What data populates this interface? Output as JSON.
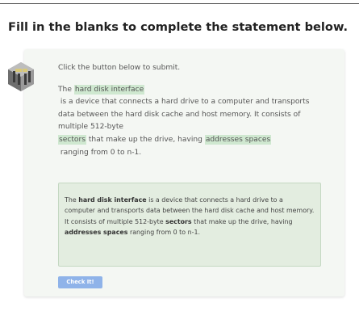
{
  "heading": "Fill in the blanks to complete the statement below.",
  "instruction": "Click the button below to submit.",
  "icons": {
    "hardware": "hard-disk-icon"
  },
  "colors": {
    "blank_highlight": "#cfe8d0",
    "card_background": "#f4f7f3",
    "answer_background": "#e3ede0",
    "button": "#8fb3e9"
  },
  "statement": {
    "prefix": "The",
    "blank1": "hard disk interface",
    "line2": "is a device that connects a hard drive to a computer and transports",
    "line3": "data between the hard disk cache and host memory. It consists of",
    "line4": "multiple 512-byte",
    "blank2": "sectors",
    "mid": "that make up the drive, having",
    "blank3": "addresses spaces",
    "line6": "ranging from 0 to n-1."
  },
  "answer": {
    "p1_a": "The",
    "p1_term": "hard disk interface",
    "p1_b": "is a device that connects a hard drive to a computer and transports data between the hard disk cache and host memory.",
    "p2_a": "It consists of multiple 512-byte",
    "p2_term1": "sectors",
    "p2_b": "that make up the drive, having",
    "p2_term2": "addresses spaces",
    "p2_c": "ranging from 0 to n-1."
  },
  "button_label": "Check It!"
}
